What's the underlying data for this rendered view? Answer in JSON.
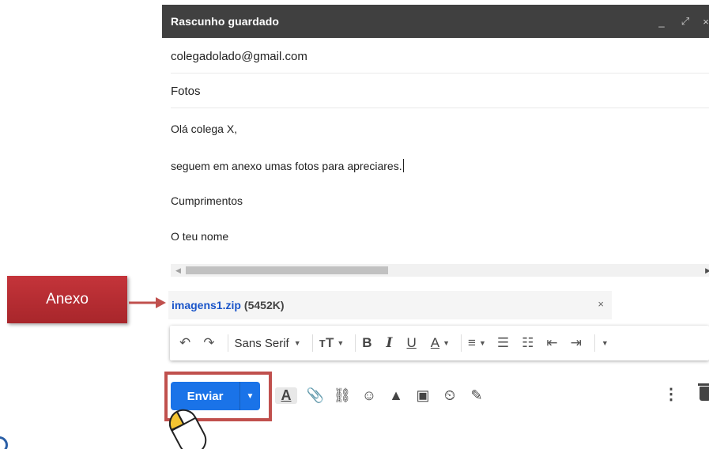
{
  "window": {
    "title": "Rascunho guardado",
    "controls": [
      "_",
      "⤢",
      "×"
    ]
  },
  "fields": {
    "to": "colegadolado@gmail.com",
    "subject": "Fotos"
  },
  "body": {
    "greeting": "Olá colega X,",
    "line1": "seguem em anexo umas fotos para apreciares.",
    "closing": "Cumprimentos",
    "signature": "O teu nome"
  },
  "attachment": {
    "filename": "imagens1.zip",
    "size": "(5452K)",
    "remove_icon": "×"
  },
  "formatting": {
    "font": "Sans Serif",
    "buttons": [
      "undo-icon",
      "redo-icon",
      "text-size-icon",
      "bold-icon",
      "italic-icon",
      "underline-icon",
      "text-color-icon",
      "align-icon",
      "numbered-list-icon",
      "bulleted-list-icon",
      "indent-less-icon",
      "indent-more-icon",
      "more-formatting-icon"
    ],
    "bold": "B",
    "italic": "I",
    "underline": "U"
  },
  "actions": {
    "send_label": "Enviar",
    "icons": [
      "formatting-options-icon",
      "attach-file-icon",
      "insert-link-icon",
      "emoji-icon",
      "google-drive-icon",
      "insert-photo-icon",
      "confidential-mode-icon",
      "signature-icon",
      "more-options-icon",
      "discard-draft-icon"
    ]
  },
  "annotation": {
    "label": "Anexo",
    "accent": "#c0504d"
  },
  "colors": {
    "titlebar": "#404040",
    "send_button": "#1a73e8",
    "attachment_link": "#1a55c9"
  }
}
